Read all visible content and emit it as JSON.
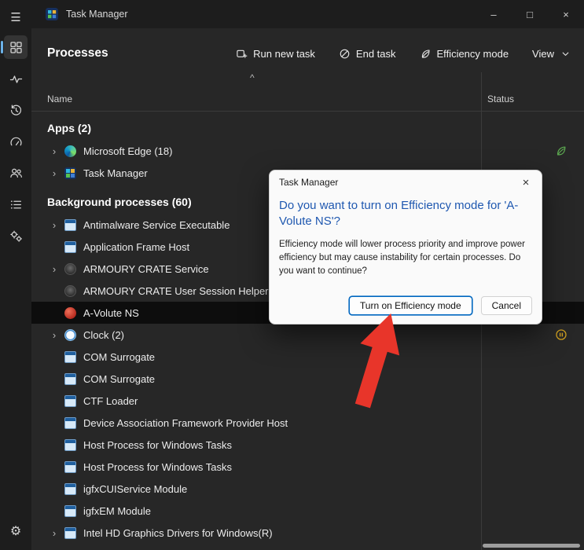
{
  "titlebar": {
    "title": "Task Manager",
    "controls": {
      "minimize": "–",
      "maximize": "□",
      "close": "×"
    }
  },
  "sidebar": {
    "items": [
      {
        "id": "menu",
        "icon": "hamburger-icon",
        "glyph": "☰"
      },
      {
        "id": "processes",
        "icon": "processes-grid-icon",
        "selected": true
      },
      {
        "id": "performance",
        "icon": "performance-pulse-icon"
      },
      {
        "id": "app-history",
        "icon": "history-icon"
      },
      {
        "id": "startup-apps",
        "icon": "startup-gauge-icon"
      },
      {
        "id": "users",
        "icon": "users-icon"
      },
      {
        "id": "details",
        "icon": "details-list-icon"
      },
      {
        "id": "services",
        "icon": "services-gears-icon"
      },
      {
        "id": "settings",
        "icon": "settings-gear-icon",
        "glyph": "⚙"
      }
    ]
  },
  "header": {
    "title": "Processes",
    "toolbar": [
      {
        "label": "Run new task",
        "icon": "new-task-icon"
      },
      {
        "label": "End task",
        "icon": "end-task-icon"
      },
      {
        "label": "Efficiency mode",
        "icon": "leaf-icon"
      },
      {
        "label": "View",
        "icon": "chevron-down-icon"
      }
    ]
  },
  "table": {
    "sort_indicator": "^",
    "columns": [
      {
        "label": "Name"
      },
      {
        "label": "Status"
      }
    ],
    "groups": [
      {
        "label": "Apps (2)",
        "rows": [
          {
            "name": "Microsoft Edge (18)",
            "icon": "edge",
            "expandable": true,
            "status_icon": "leaf"
          },
          {
            "name": "Task Manager",
            "icon": "taskmgr",
            "expandable": true
          }
        ]
      },
      {
        "label": "Background processes (60)",
        "rows": [
          {
            "name": "Antimalware Service Executable",
            "icon": "window",
            "expandable": true
          },
          {
            "name": "Application Frame Host",
            "icon": "window"
          },
          {
            "name": "ARMOURY CRATE Service",
            "icon": "armoury",
            "expandable": true
          },
          {
            "name": "ARMOURY CRATE User Session Helper",
            "icon": "armoury"
          },
          {
            "name": "A-Volute NS",
            "icon": "avolute",
            "selected": true
          },
          {
            "name": "Clock (2)",
            "icon": "clock",
            "expandable": true,
            "status_icon": "paused"
          },
          {
            "name": "COM Surrogate",
            "icon": "window"
          },
          {
            "name": "COM Surrogate",
            "icon": "window"
          },
          {
            "name": "CTF Loader",
            "icon": "window"
          },
          {
            "name": "Device Association Framework Provider Host",
            "icon": "window"
          },
          {
            "name": "Host Process for Windows Tasks",
            "icon": "window"
          },
          {
            "name": "Host Process for Windows Tasks",
            "icon": "window"
          },
          {
            "name": "igfxCUIService Module",
            "icon": "window"
          },
          {
            "name": "igfxEM Module",
            "icon": "window"
          },
          {
            "name": "Intel HD Graphics Drivers for Windows(R)",
            "icon": "window",
            "expandable": true
          }
        ]
      }
    ]
  },
  "dialog": {
    "title": "Task Manager",
    "close": "×",
    "heading": "Do you want to turn on Efficiency mode for 'A-Volute NS'?",
    "body": "Efficiency mode will lower process priority and improve power efficiency but may cause instability for certain processes. Do you want to continue?",
    "buttons": [
      {
        "label": "Turn on Efficiency mode",
        "primary": true
      },
      {
        "label": "Cancel"
      }
    ]
  },
  "colors": {
    "accent_blue": "#0067c0",
    "heading_blue": "#1f58b0",
    "leaf_green": "#5fb052",
    "paused_amber": "#cf9f1f",
    "arrow_red": "#e8352a"
  }
}
